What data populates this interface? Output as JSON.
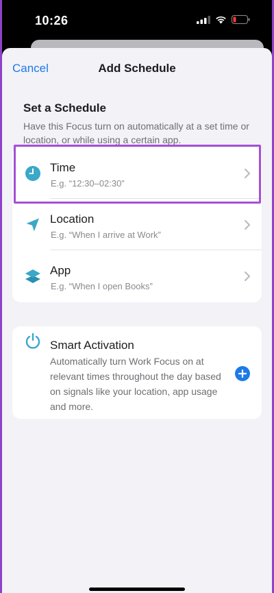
{
  "status_bar": {
    "time": "10:26"
  },
  "nav": {
    "cancel": "Cancel",
    "title": "Add Schedule"
  },
  "section": {
    "title": "Set a Schedule",
    "description": "Have this Focus turn on automatically at a set time or location, or while using a certain app."
  },
  "schedule_items": [
    {
      "label": "Time",
      "subtitle": "E.g. “12:30–02:30”",
      "icon": "clock-icon"
    },
    {
      "label": "Location",
      "subtitle": "E.g. “When I arrive at Work”",
      "icon": "location-arrow-icon"
    },
    {
      "label": "App",
      "subtitle": "E.g. “When I open Books”",
      "icon": "app-layers-icon"
    }
  ],
  "smart_activation": {
    "label": "Smart Activation",
    "description": "Automatically turn Work Focus on at relevant times throughout the day based on signals like your location, app usage and more.",
    "icon": "power-icon"
  },
  "colors": {
    "accent": "#1e7ae6",
    "icon_teal": "#3aa8c8",
    "highlight": "#a450d6",
    "background": "#f2f2f7"
  },
  "battery_level": 0.15
}
